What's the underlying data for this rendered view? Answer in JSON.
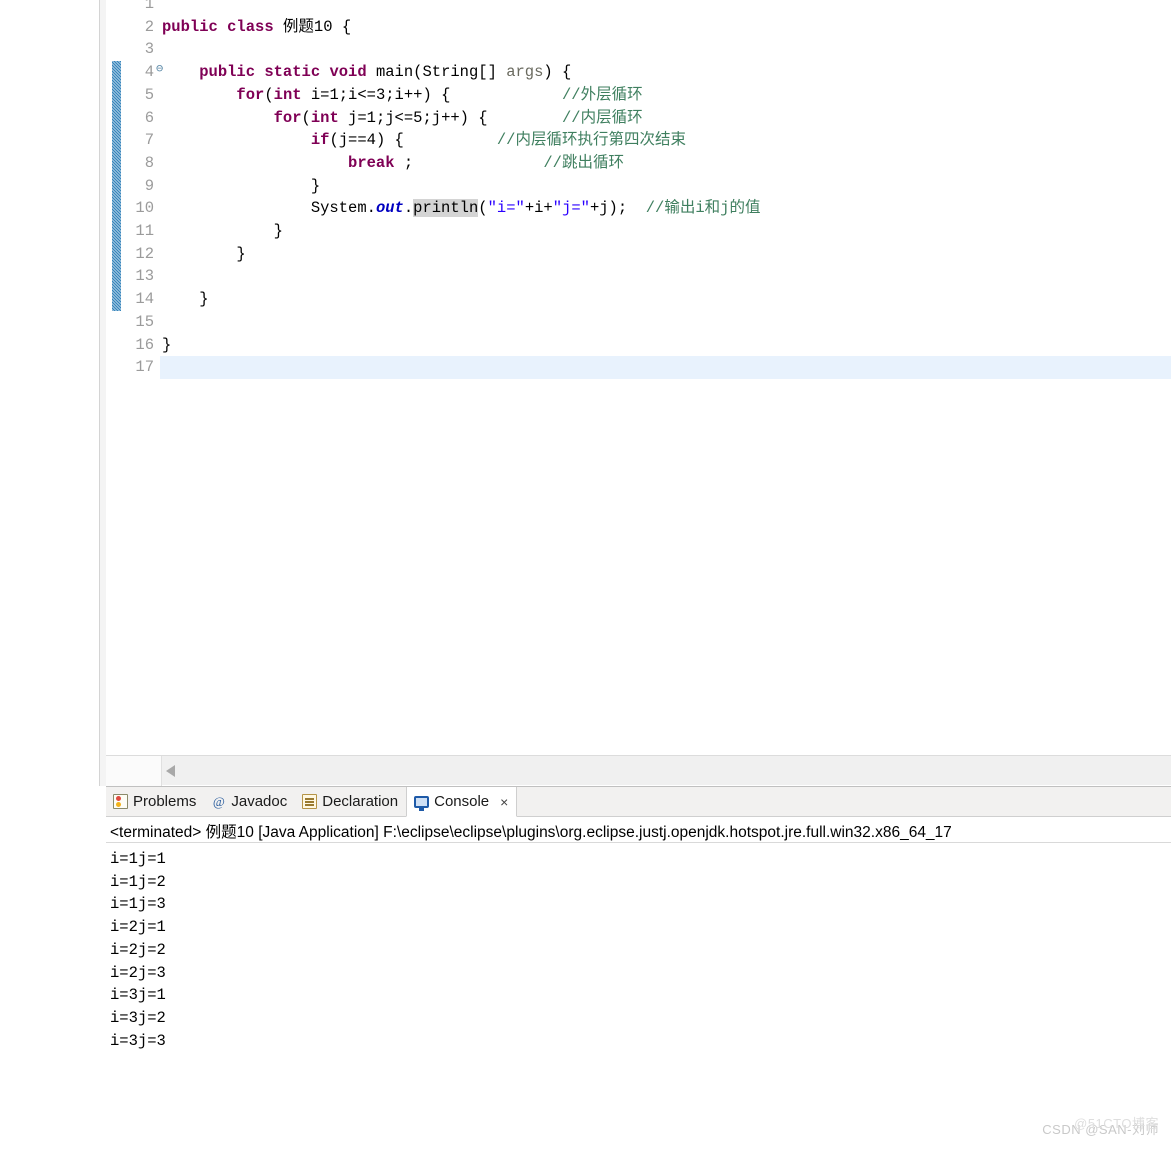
{
  "editor": {
    "first_visible_line": 1,
    "current_line": 17,
    "fold_marker_line": 4,
    "annotation_range": [
      4,
      14
    ],
    "occurrence_highlight": "println",
    "colors": {
      "keyword": "#7f0055",
      "string": "#2a00ff",
      "comment": "#3f7f5f",
      "static_field": "#0000c0",
      "parameter": "#6a6a5f",
      "current_line_bg": "#e8f2fd",
      "annotation_bar": "#2c7fb8",
      "line_number": "#9b9b9b"
    },
    "lines": [
      {
        "n": 1,
        "segments": []
      },
      {
        "n": 2,
        "segments": [
          {
            "t": "public class ",
            "c": "kw"
          },
          {
            "t": "例题10 {",
            "c": ""
          }
        ]
      },
      {
        "n": 3,
        "segments": []
      },
      {
        "n": 4,
        "fold": true,
        "segments": [
          {
            "t": "    ",
            "c": ""
          },
          {
            "t": "public static void ",
            "c": "kw"
          },
          {
            "t": "main(String[] ",
            "c": ""
          },
          {
            "t": "args",
            "c": "par"
          },
          {
            "t": ") {",
            "c": ""
          }
        ]
      },
      {
        "n": 5,
        "segments": [
          {
            "t": "        ",
            "c": ""
          },
          {
            "t": "for",
            "c": "kw"
          },
          {
            "t": "(",
            "c": ""
          },
          {
            "t": "int",
            "c": "kw"
          },
          {
            "t": " i=1;i<=3;i++) {            ",
            "c": ""
          },
          {
            "t": "//外层循环",
            "c": "cmt"
          }
        ]
      },
      {
        "n": 6,
        "segments": [
          {
            "t": "            ",
            "c": ""
          },
          {
            "t": "for",
            "c": "kw"
          },
          {
            "t": "(",
            "c": ""
          },
          {
            "t": "int",
            "c": "kw"
          },
          {
            "t": " j=1;j<=5;j++) {        ",
            "c": ""
          },
          {
            "t": "//内层循环",
            "c": "cmt"
          }
        ]
      },
      {
        "n": 7,
        "segments": [
          {
            "t": "                ",
            "c": ""
          },
          {
            "t": "if",
            "c": "kw"
          },
          {
            "t": "(j==4) {          ",
            "c": ""
          },
          {
            "t": "//内层循环执行第四次结束",
            "c": "cmt"
          }
        ]
      },
      {
        "n": 8,
        "segments": [
          {
            "t": "                    ",
            "c": ""
          },
          {
            "t": "break",
            "c": "kw"
          },
          {
            "t": " ;              ",
            "c": ""
          },
          {
            "t": "//跳出循环",
            "c": "cmt"
          }
        ]
      },
      {
        "n": 9,
        "segments": [
          {
            "t": "                }",
            "c": ""
          }
        ]
      },
      {
        "n": 10,
        "segments": [
          {
            "t": "                System.",
            "c": ""
          },
          {
            "t": "out",
            "c": "fld"
          },
          {
            "t": ".",
            "c": ""
          },
          {
            "t": "println",
            "c": "occ"
          },
          {
            "t": "(",
            "c": ""
          },
          {
            "t": "\"i=\"",
            "c": "str"
          },
          {
            "t": "+i+",
            "c": ""
          },
          {
            "t": "\"j=\"",
            "c": "str"
          },
          {
            "t": "+j);  ",
            "c": ""
          },
          {
            "t": "//输出i和j的值",
            "c": "cmt"
          }
        ]
      },
      {
        "n": 11,
        "segments": [
          {
            "t": "            }",
            "c": ""
          }
        ]
      },
      {
        "n": 12,
        "segments": [
          {
            "t": "        }",
            "c": ""
          }
        ]
      },
      {
        "n": 13,
        "segments": []
      },
      {
        "n": 14,
        "segments": [
          {
            "t": "    }",
            "c": ""
          }
        ]
      },
      {
        "n": 15,
        "segments": []
      },
      {
        "n": 16,
        "segments": [
          {
            "t": "}",
            "c": ""
          }
        ]
      },
      {
        "n": 17,
        "segments": []
      }
    ]
  },
  "scrollbar": {
    "left_arrow_icon": "triangle-left-icon"
  },
  "bottom_panel": {
    "tabs": [
      {
        "label": "Problems",
        "icon": "problems-icon",
        "active": false,
        "closable": false
      },
      {
        "label": "Javadoc",
        "icon": "javadoc-icon",
        "active": false,
        "closable": false
      },
      {
        "label": "Declaration",
        "icon": "declaration-icon",
        "active": false,
        "closable": false
      },
      {
        "label": "Console",
        "icon": "console-icon",
        "active": true,
        "closable": true
      }
    ],
    "close_glyph": "×",
    "javadoc_glyph": "@",
    "terminated_line": "<terminated> 例题10 [Java Application] F:\\eclipse\\eclipse\\plugins\\org.eclipse.justj.openjdk.hotspot.jre.full.win32.x86_64_17",
    "console_output": [
      "i=1j=1",
      "i=1j=2",
      "i=1j=3",
      "i=2j=1",
      "i=2j=2",
      "i=2j=3",
      "i=3j=1",
      "i=3j=2",
      "i=3j=3"
    ]
  },
  "watermark": {
    "primary": "CSDN @SAN-刘师",
    "secondary": "@51CTO博客"
  }
}
